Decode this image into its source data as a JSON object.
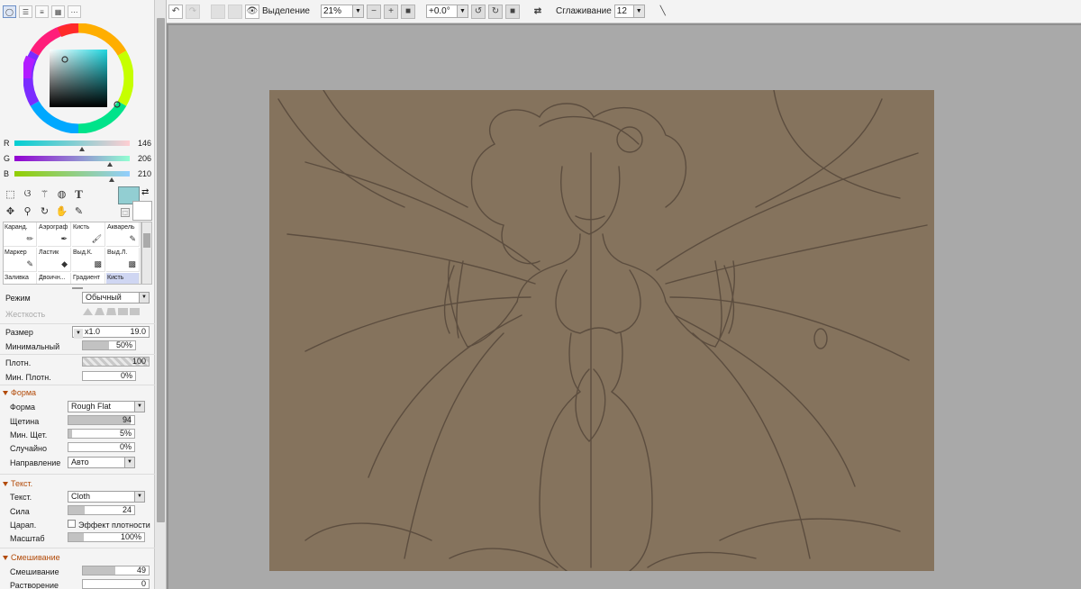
{
  "toolbar": {
    "selection_label": "Выделение",
    "zoom_value": "21%",
    "rotation_value": "+0.0°",
    "smoothing_label": "Сглаживание",
    "smoothing_value": "12"
  },
  "color": {
    "r_label": "R",
    "r_value": "146",
    "g_label": "G",
    "g_value": "206",
    "b_label": "B",
    "b_value": "210",
    "main_hex": "#92ced2",
    "secondary_hex": "#ffffff"
  },
  "brushes": [
    {
      "label": "Каранд."
    },
    {
      "label": "Аэрограф"
    },
    {
      "label": "Кисть"
    },
    {
      "label": "Акварель"
    },
    {
      "label": "Маркер"
    },
    {
      "label": "Ластик"
    },
    {
      "label": "Выд.К."
    },
    {
      "label": "Выд.Л."
    },
    {
      "label": "Заливка"
    },
    {
      "label": "Двоичн..."
    },
    {
      "label": "Градиент"
    },
    {
      "label": "Кисть"
    }
  ],
  "props": {
    "mode_label": "Режим",
    "mode_value": "Обычный",
    "hardness_label": "Жесткость",
    "size_label": "Размер",
    "size_mult": "x1.0",
    "size_value": "19.0",
    "min_label": "Минимальный",
    "min_value": "50%",
    "density_label": "Плотн.",
    "density_value": "100",
    "min_density_label": "Мин. Плотн.",
    "min_density_value": "0%"
  },
  "shape_section": {
    "title": "Форма",
    "form_label": "Форма",
    "form_value": "Rough Flat",
    "bristle_label": "Щетина",
    "bristle_value": "94",
    "min_bristle_label": "Мин. Щет.",
    "min_bristle_value": "5%",
    "random_label": "Случайно",
    "random_value": "0%",
    "direction_label": "Направление",
    "direction_value": "Авто"
  },
  "texture_section": {
    "title": "Текст.",
    "texture_label": "Текст.",
    "texture_value": "Cloth",
    "strength_label": "Сила",
    "strength_value": "24",
    "scratch_label": "Царап.",
    "density_effect_label": "Эффект плотности",
    "scale_label": "Масштаб",
    "scale_value": "100%"
  },
  "mix_section": {
    "title": "Смешивание",
    "mixing_label": "Смешивание",
    "mixing_value": "49",
    "dilution_label": "Растворение",
    "dilution_value": "0"
  },
  "canvas": {
    "background_hex": "#a9a9a9",
    "paper_hex": "#85735d",
    "line_hex": "#55473a"
  }
}
